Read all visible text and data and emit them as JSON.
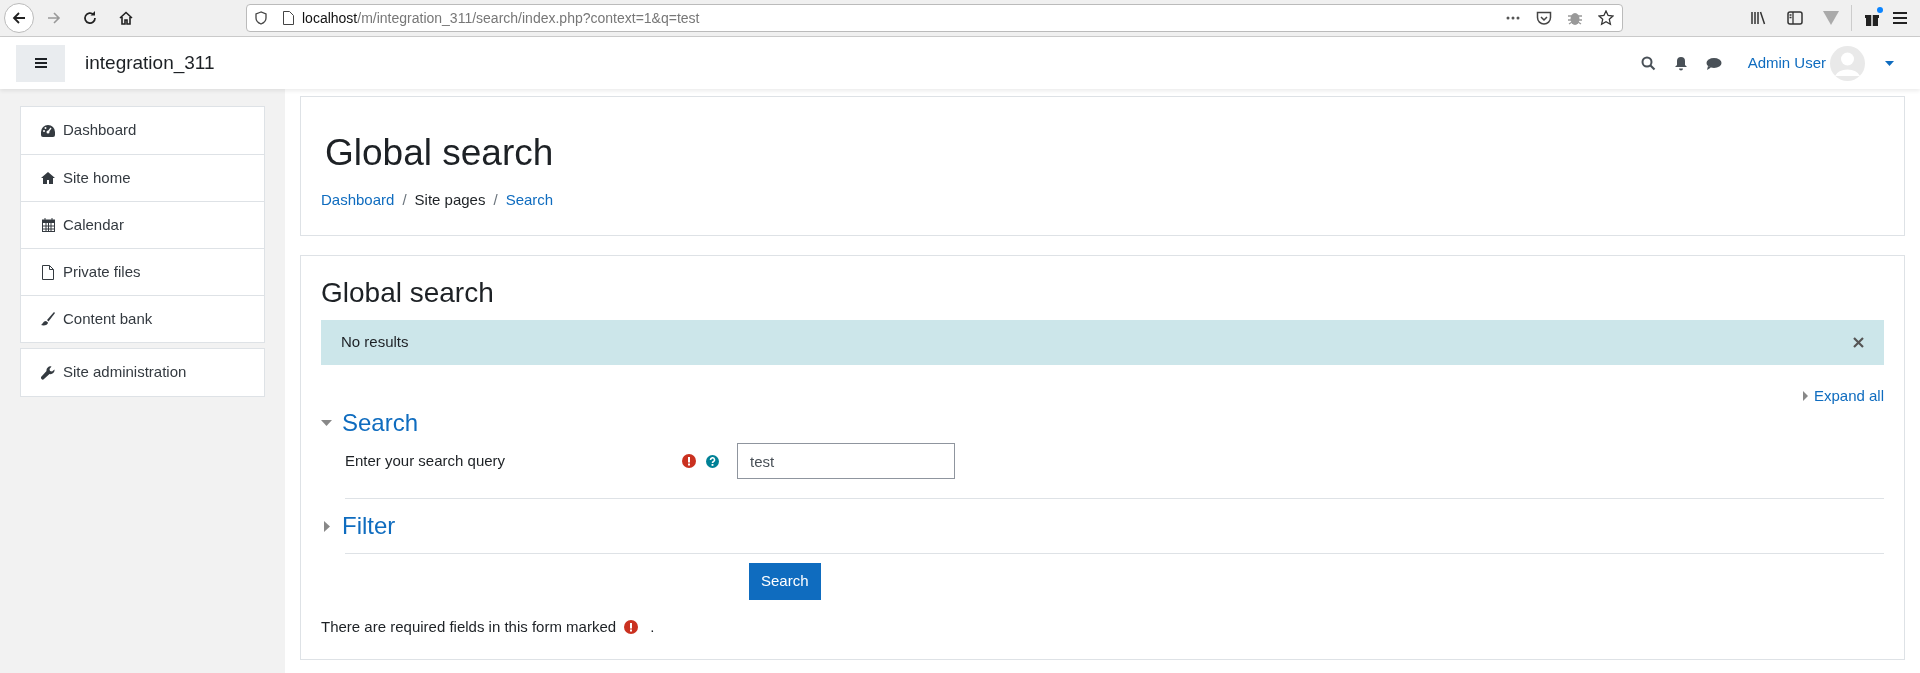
{
  "browser": {
    "url_host": "localhost",
    "url_path": "/m/integration_311/search/index.php?context=1&q=test",
    "notification": true
  },
  "navbar": {
    "site_name": "integration_311",
    "user_name": "Admin User"
  },
  "sidebar": {
    "groups": [
      {
        "items": [
          {
            "label": "Dashboard"
          },
          {
            "label": "Site home"
          },
          {
            "label": "Calendar"
          },
          {
            "label": "Private files"
          },
          {
            "label": "Content bank"
          }
        ]
      },
      {
        "items": [
          {
            "label": "Site administration"
          }
        ]
      }
    ]
  },
  "page_header": {
    "title": "Global search",
    "breadcrumbs": [
      {
        "label": "Dashboard",
        "link": true
      },
      {
        "separator": "/",
        "label": "Site pages",
        "link": false
      },
      {
        "separator": "/",
        "label": "Search",
        "link": true
      }
    ]
  },
  "main": {
    "heading": "Global search",
    "alert": {
      "text": "No results"
    },
    "expand_all": "Expand all",
    "sections": [
      {
        "title": "Search",
        "expanded": true,
        "fields": [
          {
            "label": "Enter your search query",
            "required": true,
            "help": true,
            "value": "test"
          }
        ]
      },
      {
        "title": "Filter",
        "expanded": false
      }
    ],
    "submit_button": "Search",
    "required_note": {
      "before": "There are required fields in this form marked",
      "after": "."
    }
  }
}
